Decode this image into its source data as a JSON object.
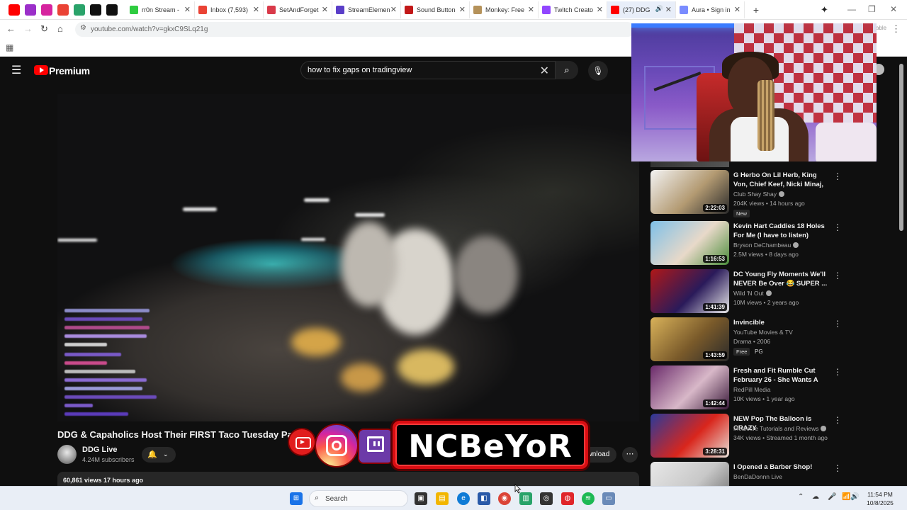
{
  "browser": {
    "pinned_tabs": [
      {
        "icon": "youtube-icon",
        "color": "#ff0000"
      },
      {
        "icon": "patreon-p-icon",
        "color": "#9b2fc9"
      },
      {
        "icon": "instagram-icon",
        "color": "#d6249f"
      },
      {
        "icon": "gmail-icon",
        "color": "#ea4335"
      },
      {
        "icon": "sheets-icon",
        "color": "#2aa36a"
      },
      {
        "icon": "tv-icon",
        "color": "#111111"
      },
      {
        "icon": "capcut-icon",
        "color": "#111111"
      }
    ],
    "tabs": [
      {
        "label": "rr0n Stream -",
        "fav": "#2ecc40"
      },
      {
        "label": "Inbox (7,593)",
        "fav": "#ea4335"
      },
      {
        "label": "SetAndForget",
        "fav": "#d93a4a"
      },
      {
        "label": "StreamElemen",
        "fav": "#5a3ec8"
      },
      {
        "label": "Sound Button",
        "fav": "#c21818"
      },
      {
        "label": "Monkey: Free",
        "fav": "#b5925a"
      },
      {
        "label": "Twitch Creato",
        "fav": "#9146ff"
      },
      {
        "label": "(27) DDG",
        "fav": "#ff0000",
        "active": true
      },
      {
        "label": "Aura • Sign in",
        "fav": "#7a8cff"
      }
    ],
    "new_tab_symbol": "+",
    "url": "youtube.com/watch?v=gkxC9SLq21g",
    "ext_peek": "able"
  },
  "youtube": {
    "brand": "Premium",
    "search_query": "how to fix gaps on tradingview",
    "video": {
      "title": "DDG & Capaholics Host Their FIRST Taco Tuesday Party",
      "channel": "DDG Live",
      "subscribers": "4.24M subscribers",
      "download_label": "ownload",
      "views_time": "60,861 views  17 hours ago"
    },
    "recommendations": [
      {
        "title": "G Herbo On Lil Herb, King Von, Chief Keef, Nicki Minaj, Juice ...",
        "channel": "Club Shay Shay",
        "verified": true,
        "meta": "204K views • 14 hours ago",
        "duration": "2:22:03",
        "badge": "New",
        "thumb": [
          "#f3f3f3",
          "#b39a72",
          "#2a2a2a"
        ]
      },
      {
        "title": "Kevin Hart Caddies 18 Holes For Me (I have to listen)",
        "channel": "Bryson DeChambeau",
        "verified": true,
        "meta": "2.5M views • 8 days ago",
        "duration": "1:16:53",
        "thumb": [
          "#7ec0e8",
          "#e8d9c9",
          "#4a8c3a"
        ]
      },
      {
        "title": "DC Young Fly Moments We'll NEVER Be Over 😂 SUPER ...",
        "channel": "Wild 'N Out",
        "verified": true,
        "meta": "10M views • 2 years ago",
        "duration": "1:41:39",
        "thumb": [
          "#b01818",
          "#2a1a5a",
          "#e8e8e8"
        ]
      },
      {
        "title": "Invincible",
        "channel": "YouTube Movies & TV",
        "meta": "Drama • 2006",
        "duration": "1:43:59",
        "badge": "Free",
        "badge2": "PG",
        "thumb": [
          "#d9b25a",
          "#7a5a2a",
          "#2a2a2a"
        ]
      },
      {
        "title": "Fresh and Fit Rumble Cut February 26 - She Wants A Ma...",
        "channel": "RedPill Media",
        "meta": "10K views • 1 year ago",
        "duration": "1:42:44",
        "thumb": [
          "#6a2a6a",
          "#d8b8c8",
          "#3a1a3a"
        ]
      },
      {
        "title": "NEW Pop The Balloon is CRAZY",
        "channel": "Mediocre Tutorials and Reviews",
        "verified": true,
        "meta": "34K views • Streamed 1 month ago",
        "duration": "3:28:31",
        "thumb": [
          "#2a3a9a",
          "#d9261c",
          "#e8e0d8"
        ]
      },
      {
        "title": "I Opened a Barber Shop!",
        "channel": "BenDaDonnn Live",
        "meta": "",
        "duration": "",
        "thumb": [
          "#e8e8e8",
          "#c8c8c8",
          "#6a6a6a"
        ]
      }
    ]
  },
  "overlay": {
    "brand_name": "NCBeYoR"
  },
  "taskbar": {
    "search_placeholder": "Search",
    "time": "11:54 PM",
    "date": "10/8/2025"
  }
}
